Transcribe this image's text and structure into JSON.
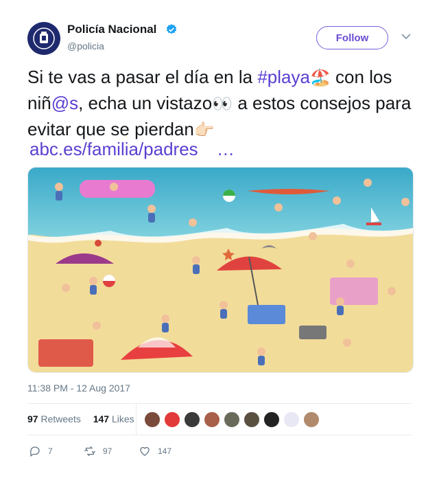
{
  "account": {
    "name": "Policía Nacional",
    "handle": "@policia",
    "verified": true
  },
  "header": {
    "follow_label": "Follow"
  },
  "tweet": {
    "seg1": "Si te vas a pasar el día en la ",
    "hashtag": "#playa",
    "seg2": " con los niñ",
    "mention": "@s",
    "seg3": ", echa un vistazo",
    "seg4": " a estos consejos para evitar que se pierdan",
    "url": "abc.es/familia/padres",
    "ellipsis": "…",
    "emoji_1": "🏖️",
    "emoji_2": "👀",
    "emoji_3": "👉🏻"
  },
  "meta": {
    "timestamp": "11:38 PM - 12 Aug 2017"
  },
  "stats": {
    "retweets_count": "97",
    "retweets_label": "Retweets",
    "likes_count": "147",
    "likes_label": "Likes"
  },
  "actions": {
    "reply_count": "7",
    "retweet_count": "97",
    "like_count": "147"
  },
  "colors": {
    "accent": "#6a4bd1",
    "link": "#5b3fd1",
    "verified": "#1da1f2",
    "muted": "#657786"
  }
}
